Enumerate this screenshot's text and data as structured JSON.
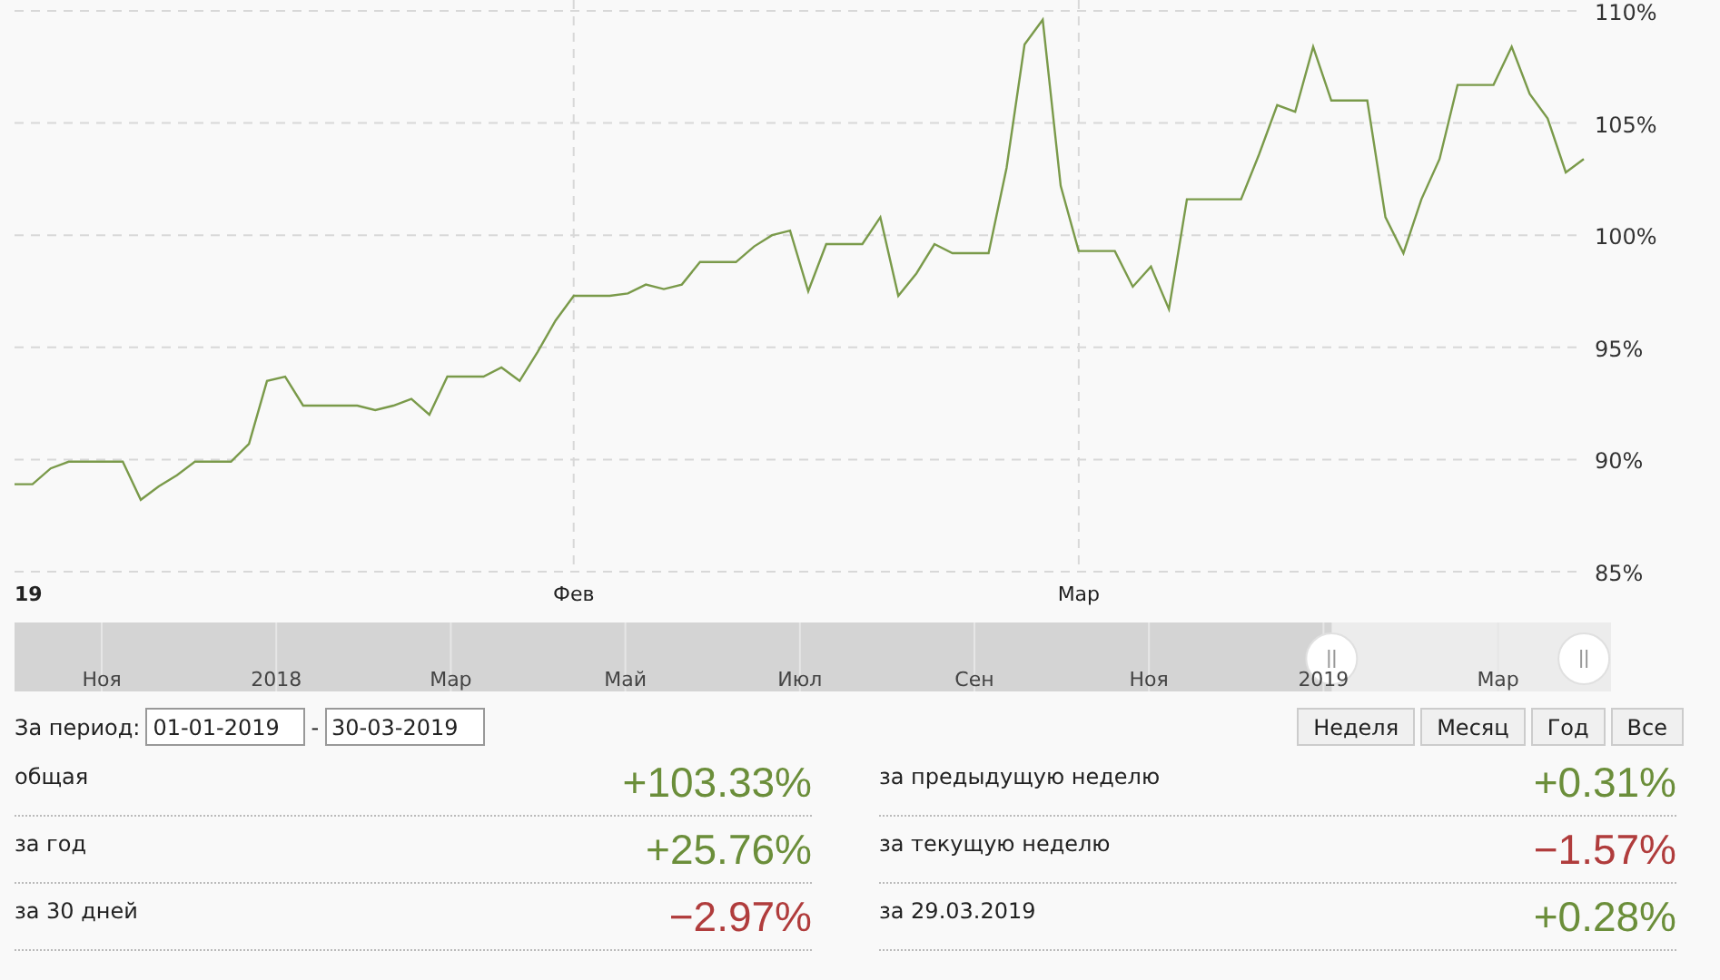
{
  "chart": {
    "chart_data": {
      "type": "line",
      "grid": true,
      "ylim": [
        85,
        110
      ],
      "categories": [
        "19",
        null,
        null,
        null,
        null,
        null,
        null,
        null,
        null,
        null,
        null,
        null,
        null,
        null,
        null,
        null,
        null,
        null,
        null,
        null,
        null,
        null,
        null,
        null,
        null,
        null,
        null,
        null,
        null,
        null,
        null,
        "Фев",
        null,
        null,
        null,
        null,
        null,
        null,
        null,
        null,
        null,
        null,
        null,
        null,
        null,
        null,
        null,
        null,
        null,
        null,
        null,
        null,
        null,
        null,
        null,
        null,
        null,
        null,
        null,
        "Мар",
        null,
        null,
        null,
        null,
        null,
        null,
        null,
        null,
        null,
        null,
        null,
        null,
        null,
        null,
        null,
        null,
        null,
        null,
        null,
        null,
        null,
        null,
        null,
        null,
        null,
        null,
        null,
        null
      ],
      "series": [
        {
          "color": "#7a9a4a",
          "values": [
            88.9,
            88.9,
            89.6,
            89.9,
            89.9,
            89.9,
            89.9,
            88.2,
            88.8,
            89.3,
            89.9,
            89.9,
            89.9,
            90.7,
            93.5,
            93.7,
            92.4,
            92.4,
            92.4,
            92.4,
            92.2,
            92.4,
            92.7,
            92.0,
            93.7,
            93.7,
            93.7,
            94.1,
            93.5,
            94.8,
            96.2,
            97.3,
            97.3,
            97.3,
            97.4,
            97.8,
            97.6,
            97.8,
            98.8,
            98.8,
            98.8,
            99.5,
            100.0,
            100.2,
            97.5,
            99.6,
            99.6,
            99.6,
            100.8,
            97.3,
            98.3,
            99.6,
            99.2,
            99.2,
            99.2,
            103.0,
            108.5,
            109.6,
            102.2,
            99.3,
            99.3,
            99.3,
            97.7,
            98.6,
            96.7,
            101.6,
            101.6,
            101.6,
            101.6,
            103.6,
            105.8,
            105.5,
            108.4,
            106.0,
            106.0,
            106.0,
            100.8,
            99.2,
            101.6,
            103.4,
            106.7,
            106.7,
            106.7,
            108.4,
            106.3,
            105.2,
            102.8,
            103.4
          ]
        }
      ],
      "yticks": [
        {
          "value": 85,
          "label": "85%"
        },
        {
          "value": 90,
          "label": "90%"
        },
        {
          "value": 95,
          "label": "95%"
        },
        {
          "value": 100,
          "label": "100%"
        },
        {
          "value": 105,
          "label": "105%"
        },
        {
          "value": 110,
          "label": "110%"
        }
      ]
    }
  },
  "navigator": {
    "ticks": [
      "Ноя",
      "2018",
      "Мар",
      "Май",
      "Июл",
      "Сен",
      "Ноя",
      "2019",
      "Мар"
    ],
    "start_handle": {
      "level": 0.825
    },
    "end_handle": {
      "level": 0.983
    }
  },
  "period": {
    "label": "За период:",
    "from": "01-01-2019",
    "separator": "-",
    "to": "30-03-2019"
  },
  "range_buttons": [
    {
      "label": "Неделя"
    },
    {
      "label": "Месяц"
    },
    {
      "label": "Год"
    },
    {
      "label": "Все"
    }
  ],
  "stats": {
    "left": [
      {
        "label": "общая",
        "value": "+103.33%",
        "color": "#6b8e3a"
      },
      {
        "label": "за год",
        "value": "+25.76%",
        "color": "#6b8e3a"
      },
      {
        "label": "за 30 дней",
        "value": "−2.97%",
        "color": "#b03c3c"
      }
    ],
    "right": [
      {
        "label": "за предыдущую неделю",
        "value": "+0.31%",
        "color": "#6b8e3a"
      },
      {
        "label": "за текущую неделю",
        "value": "−1.57%",
        "color": "#b03c3c"
      },
      {
        "label": "за 29.03.2019",
        "value": "+0.28%",
        "color": "#6b8e3a"
      }
    ]
  }
}
